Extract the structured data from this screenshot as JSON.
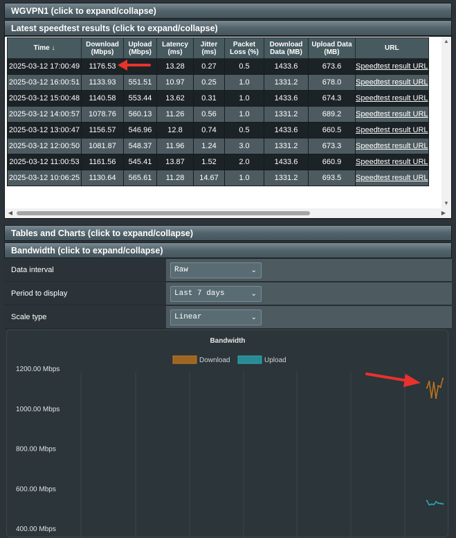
{
  "sections": {
    "wgvpn": "WGVPN1 (click to expand/collapse)",
    "speedtest": "Latest speedtest results (click to expand/collapse)",
    "tables_charts": "Tables and Charts (click to expand/collapse)",
    "bandwidth": "Bandwidth (click to expand/collapse)"
  },
  "table": {
    "headers": [
      "Time ↓",
      "Download (Mbps)",
      "Upload (Mbps)",
      "Latency (ms)",
      "Jitter (ms)",
      "Packet Loss (%)",
      "Download Data (MB)",
      "Upload Data (MB)",
      "URL"
    ],
    "rows": [
      [
        "2025-03-12 17:00:49",
        "1176.53",
        "",
        "13.28",
        "0.27",
        "0.5",
        "1433.6",
        "673.6",
        "Speedtest result URL"
      ],
      [
        "2025-03-12 16:00:51",
        "1133.93",
        "551.51",
        "10.97",
        "0.25",
        "1.0",
        "1331.2",
        "678.0",
        "Speedtest result URL"
      ],
      [
        "2025-03-12 15:00:48",
        "1140.58",
        "553.44",
        "13.62",
        "0.31",
        "1.0",
        "1433.6",
        "674.3",
        "Speedtest result URL"
      ],
      [
        "2025-03-12 14:00:57",
        "1078.76",
        "560.13",
        "11.26",
        "0.56",
        "1.0",
        "1331.2",
        "689.2",
        "Speedtest result URL"
      ],
      [
        "2025-03-12 13:00:47",
        "1156.57",
        "546.96",
        "12.8",
        "0.74",
        "0.5",
        "1433.6",
        "660.5",
        "Speedtest result URL"
      ],
      [
        "2025-03-12 12:00:50",
        "1081.87",
        "548.37",
        "11.96",
        "1.24",
        "3.0",
        "1331.2",
        "673.3",
        "Speedtest result URL"
      ],
      [
        "2025-03-12 11:00:53",
        "1161.56",
        "545.41",
        "13.87",
        "1.52",
        "2.0",
        "1433.6",
        "660.9",
        "Speedtest result URL"
      ],
      [
        "2025-03-12 10:06:25",
        "1130.64",
        "565.61",
        "11.28",
        "14.67",
        "1.0",
        "1331.2",
        "693.5",
        "Speedtest result URL"
      ]
    ]
  },
  "settings": [
    {
      "label": "Data interval",
      "value": "Raw"
    },
    {
      "label": "Period to display",
      "value": "Last 7 days"
    },
    {
      "label": "Scale type",
      "value": "Linear"
    }
  ],
  "colors": {
    "download": "#c4761c",
    "upload": "#2aa8b4",
    "arrow": "#e8322c"
  },
  "chart_data": {
    "type": "line",
    "title": "Bandwidth",
    "legend": [
      "Download",
      "Upload"
    ],
    "ytick_labels": [
      "1200.00 Mbps",
      "1000.00 Mbps",
      "800.00 Mbps",
      "600.00 Mbps",
      "400.00 Mbps"
    ],
    "yticks": [
      1200,
      1000,
      800,
      600,
      400
    ],
    "ylim": [
      400,
      1200
    ],
    "grid": true,
    "series": [
      {
        "name": "Download",
        "values": [
          1130.64,
          1161.56,
          1081.87,
          1156.57,
          1078.76,
          1140.58,
          1133.93,
          1176.53
        ]
      },
      {
        "name": "Upload",
        "values": [
          565.61,
          545.41,
          548.37,
          546.96,
          560.13,
          553.44,
          551.51,
          550.0
        ]
      }
    ]
  }
}
